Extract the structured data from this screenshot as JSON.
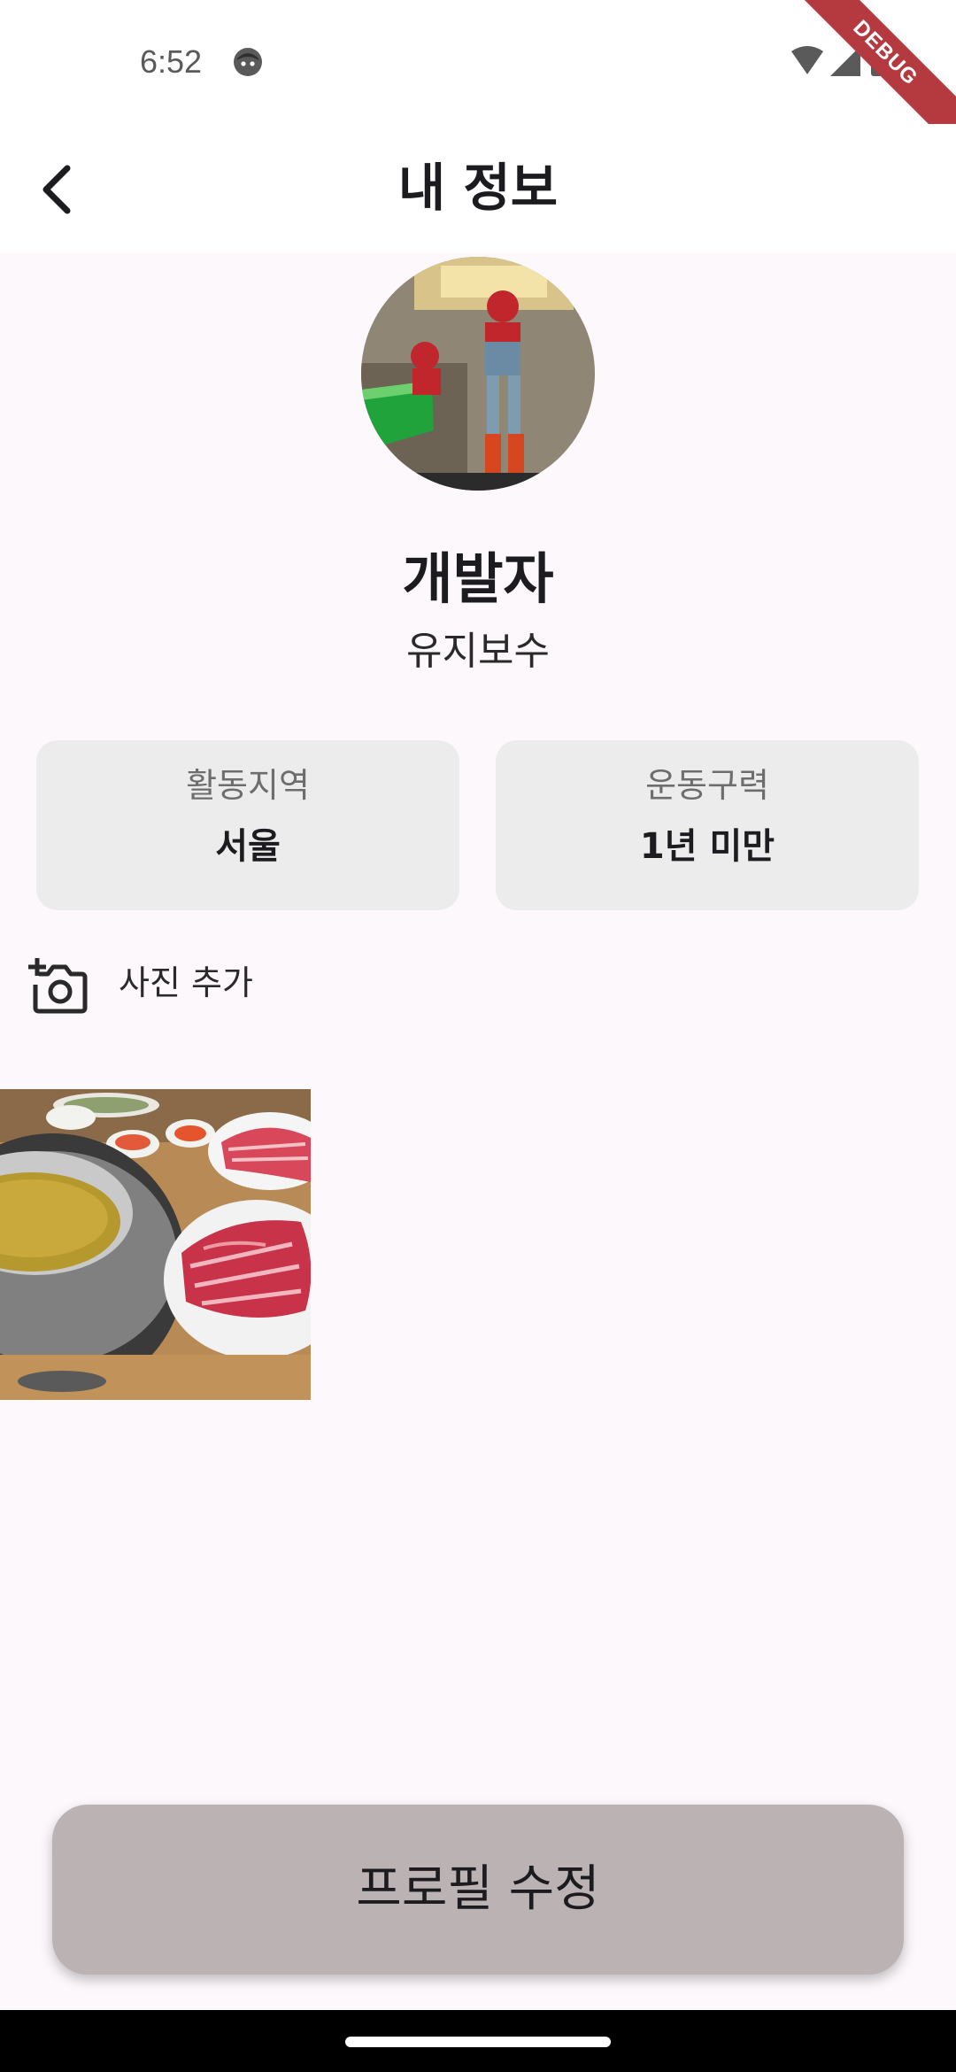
{
  "status_bar": {
    "time": "6:52",
    "debug_label": "DEBUG",
    "icons": [
      "face-icon",
      "wifi-icon",
      "signal-icon",
      "battery-icon"
    ]
  },
  "app_bar": {
    "title": "내 정보",
    "back_icon": "chevron-left-icon"
  },
  "profile": {
    "nickname": "개발자",
    "subtitle": "유지보수",
    "cards": [
      {
        "label": "활동지역",
        "value": "서울"
      },
      {
        "label": "운동구력",
        "value": "1년 미만"
      }
    ]
  },
  "photos": {
    "add_label": "사진 추가",
    "add_icon": "add-photo-camera-icon"
  },
  "actions": {
    "edit_profile_label": "프로필 수정"
  },
  "colors": {
    "background": "#fdf8fc",
    "card": "#ececec",
    "button": "#bbb3b3",
    "debug_banner": "#b43a3f"
  }
}
